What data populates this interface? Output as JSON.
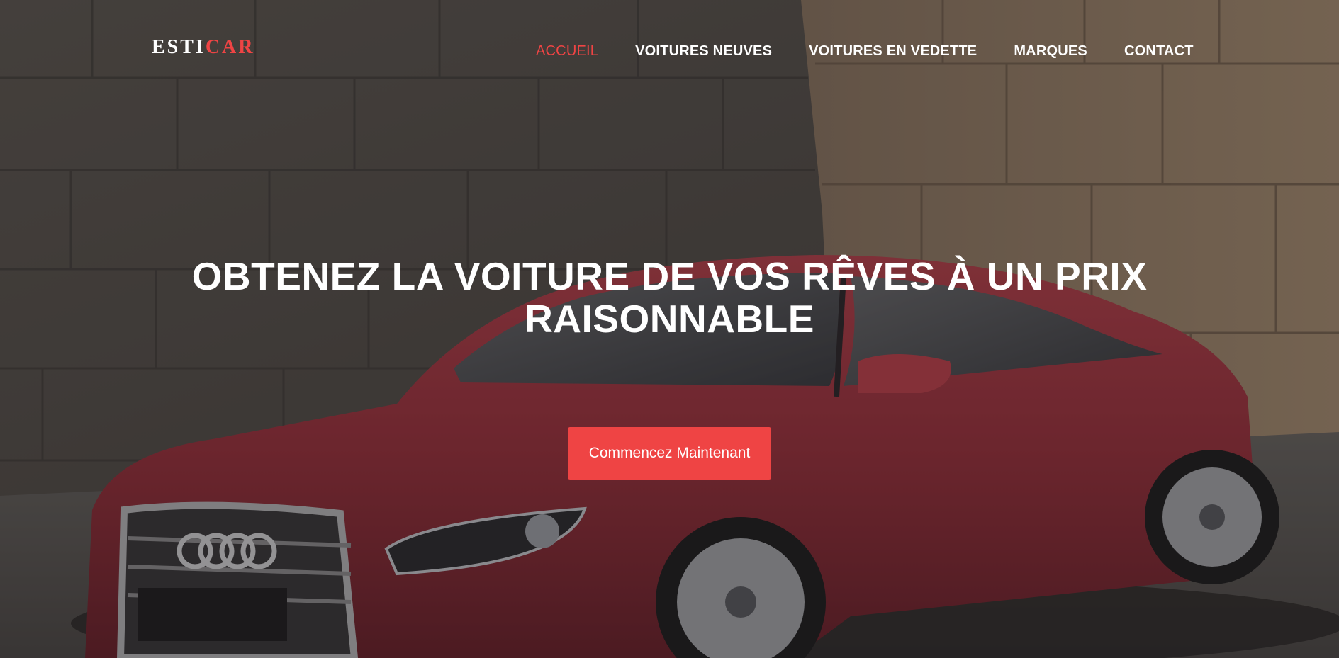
{
  "brand": {
    "logo_part1": "ESTI",
    "logo_part2": "CAR",
    "accent_color": "#ef4444"
  },
  "nav": {
    "items": [
      {
        "label": "ACCUEIL",
        "active": true
      },
      {
        "label": "VOITURES NEUVES",
        "active": false
      },
      {
        "label": "VOITURES EN VEDETTE",
        "active": false
      },
      {
        "label": "MARQUES",
        "active": false
      },
      {
        "label": "CONTACT",
        "active": false
      }
    ]
  },
  "hero": {
    "title_line1": "OBTENEZ LA VOITURE DE VOS RÊVES À UN PRIX",
    "title_line2": "RAISONNABLE",
    "cta_label": "Commencez Maintenant"
  }
}
